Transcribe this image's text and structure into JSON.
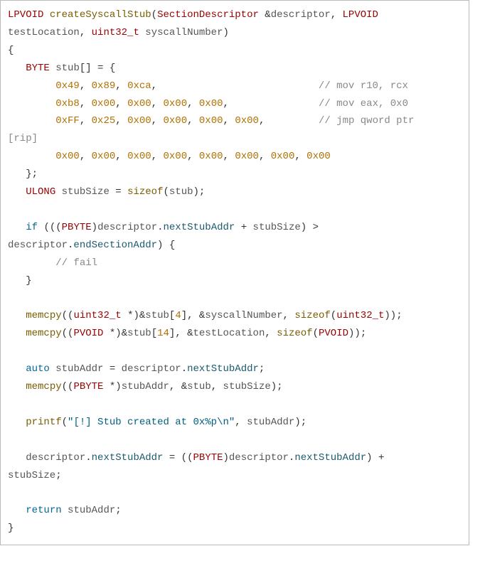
{
  "sig": {
    "ret": "LPVOID",
    "name": "createSyscallStub",
    "p1_type": "SectionDescriptor",
    "amp": "&",
    "p1_name": "descriptor",
    "p2_type": "LPVOID",
    "p2_name": "testLocation",
    "p3_type": "uint32_t",
    "p3_name": "syscallNumber"
  },
  "stub_decl": {
    "type": "BYTE",
    "name": "stub",
    "brackets": "[]",
    "eq": " = {"
  },
  "row1": {
    "b0": "0x49",
    "b1": "0x89",
    "b2": "0xca",
    "comment": "// mov r10, rcx"
  },
  "row2": {
    "b0": "0xb8",
    "b1": "0x00",
    "b2": "0x00",
    "b3": "0x00",
    "b4": "0x00",
    "comment": "// mov eax, 0x0"
  },
  "row3": {
    "b0": "0xFF",
    "b1": "0x25",
    "b2": "0x00",
    "b3": "0x00",
    "b4": "0x00",
    "b5": "0x00",
    "comment": "// jmp qword ptr"
  },
  "row3_tail": "[rip]",
  "row4": {
    "b0": "0x00",
    "b1": "0x00",
    "b2": "0x00",
    "b3": "0x00",
    "b4": "0x00",
    "b5": "0x00",
    "b6": "0x00",
    "b7": "0x00"
  },
  "close_arr": "};",
  "stubsize": {
    "type": "ULONG",
    "name": "stubSize",
    "sizeof": "sizeof",
    "arg": "stub"
  },
  "ifline": {
    "kw": "if",
    "cast": "PBYTE",
    "obj": "descriptor",
    "f1": "nextStubAddr",
    "plus": "+",
    "v": "stubSize",
    "gt": ">",
    "obj2": "descriptor",
    "f2": "endSectionAddr"
  },
  "failcomment": "// fail",
  "mc1": {
    "fn": "memcpy",
    "cast": "uint32_t",
    "amp": "&",
    "arr": "stub",
    "idx": "4",
    "arg2": "syscallNumber",
    "sz": "sizeof",
    "szarg": "uint32_t"
  },
  "mc2": {
    "fn": "memcpy",
    "cast": "PVOID",
    "amp": "&",
    "arr": "stub",
    "idx": "14",
    "arg2": "testLocation",
    "sz": "sizeof",
    "szarg": "PVOID"
  },
  "assign": {
    "kw": "auto",
    "lhs": "stubAddr",
    "obj": "descriptor",
    "field": "nextStubAddr"
  },
  "mc3": {
    "fn": "memcpy",
    "cast": "PBYTE",
    "ptr": "stubAddr",
    "arg2": "stub",
    "v": "stubSize"
  },
  "pf": {
    "fn": "printf",
    "str": "\"[!] Stub created at 0x%p\\n\"",
    "arg": "stubAddr"
  },
  "upd": {
    "obj": "descriptor",
    "field": "nextStubAddr",
    "cast": "PBYTE",
    "obj2": "descriptor",
    "field2": "nextStubAddr",
    "v": "stubSize"
  },
  "ret": {
    "kw": "return",
    "v": "stubAddr"
  }
}
